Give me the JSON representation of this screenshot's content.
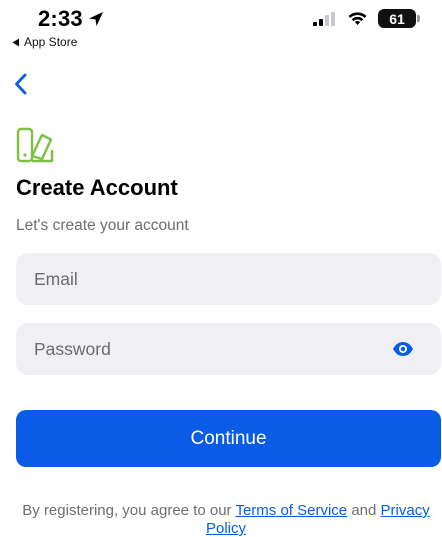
{
  "status_bar": {
    "time": "2:33",
    "back_app": "App Store",
    "battery": "61"
  },
  "header": {
    "title": "Create Account",
    "subtitle": "Let's create your account"
  },
  "form": {
    "email_placeholder": "Email",
    "password_placeholder": "Password",
    "continue_label": "Continue"
  },
  "legal": {
    "prefix": "By registering, you agree to our ",
    "terms_link": "Terms of Service",
    "middle": " and ",
    "privacy_link": "Privacy Policy"
  },
  "colors": {
    "accent": "#0a5ce6",
    "logo_green": "#7cc242",
    "field_bg": "#efeff4"
  },
  "icons": [
    "location-arrow-icon",
    "back-triangle-icon",
    "signal-icon",
    "wifi-icon",
    "battery-icon",
    "chevron-left-icon",
    "app-logo-icon",
    "eye-icon"
  ]
}
